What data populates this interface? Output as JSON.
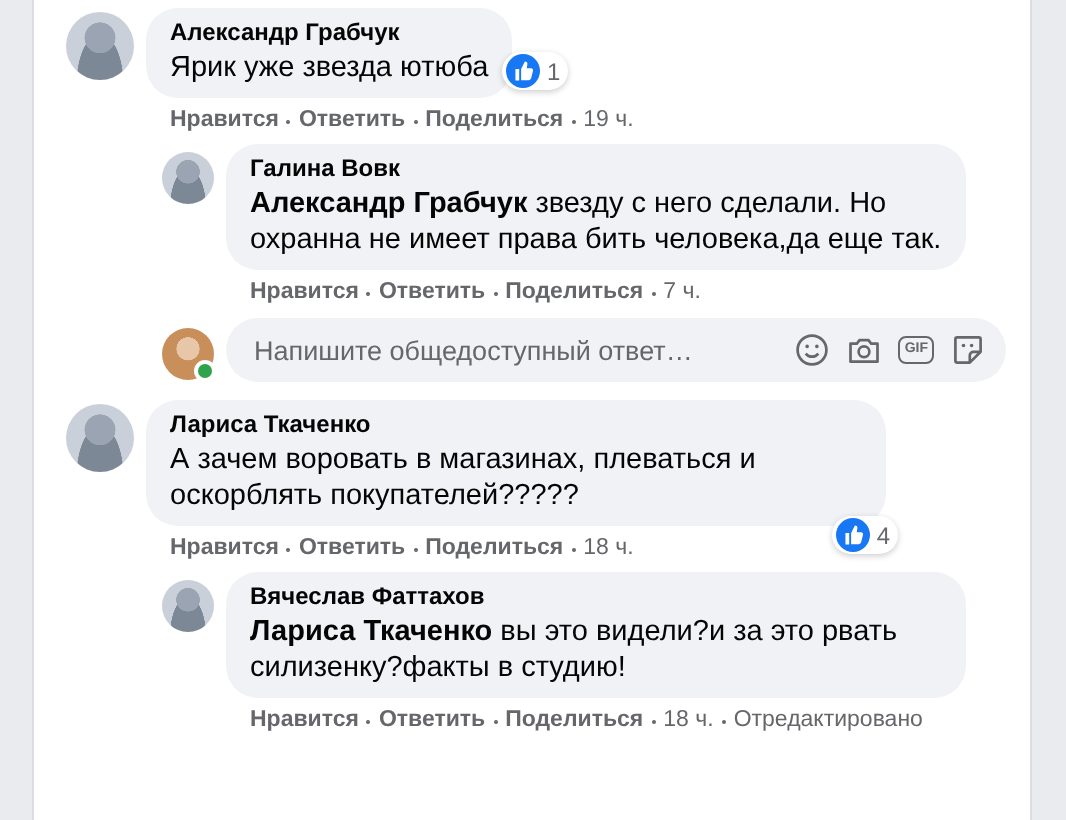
{
  "comments": [
    {
      "author": "Александр Грабчук",
      "text": "Ярик уже звезда ютюба",
      "reactions": "1",
      "actions": [
        "Нравится",
        "Ответить",
        "Поделиться"
      ],
      "time": "19 ч.",
      "replies": [
        {
          "author": "Галина Вовк",
          "text": "**Александр Грабчук** звезду с него сделали. Но охранна не имеет права бить человека,да еще так.",
          "actions": [
            "Нравится",
            "Ответить",
            "Поделиться"
          ],
          "time": "7 ч."
        }
      ],
      "reply_field": {
        "placeholder": "Напишите общедоступный ответ…",
        "online": true,
        "gif_label": "GIF"
      }
    },
    {
      "author": "Лариса Ткаченко",
      "text": "А зачем воровать в магазинах, плеваться и оскорблять покупателей?????",
      "reactions": "4",
      "actions": [
        "Нравится",
        "Ответить",
        "Поделиться"
      ],
      "time": "18 ч.",
      "replies": [
        {
          "author": "Вячеслав Фаттахов",
          "text": "**Лариса Ткаченко** вы это видели?и за это рвать силизенку?факты в студию!",
          "actions": [
            "Нравится",
            "Ответить",
            "Поделиться"
          ],
          "time": "18 ч.",
          "edited": "Отредактировано"
        }
      ]
    }
  ]
}
